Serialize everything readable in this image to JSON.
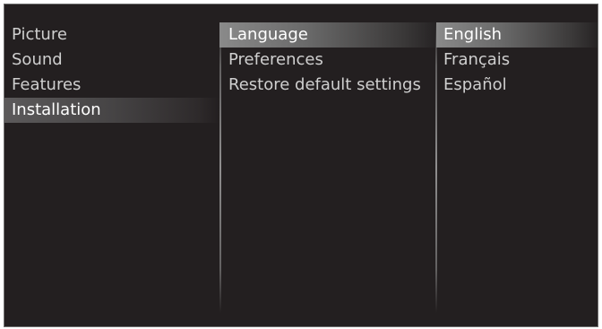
{
  "menu": {
    "main_items": [
      {
        "label": "Picture"
      },
      {
        "label": "Sound"
      },
      {
        "label": "Features"
      },
      {
        "label": "Installation"
      }
    ],
    "sub_items": [
      {
        "label": "Language"
      },
      {
        "label": "Preferences"
      },
      {
        "label": "Restore default settings"
      }
    ],
    "options": [
      {
        "label": "English"
      },
      {
        "label": "Français"
      },
      {
        "label": "Español"
      }
    ]
  }
}
